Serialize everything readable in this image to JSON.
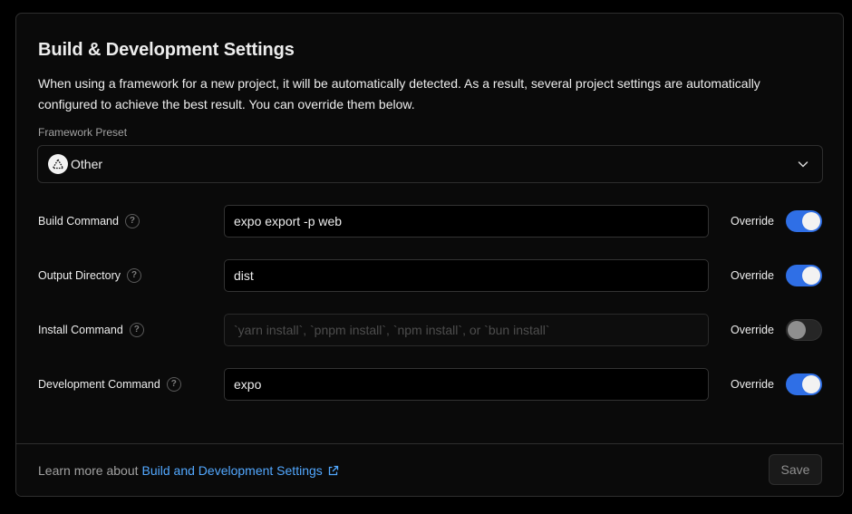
{
  "section": {
    "title": "Build & Development Settings",
    "description": "When using a framework for a new project, it will be automatically detected. As a result, several project settings are automatically configured to achieve the best result. You can override them below."
  },
  "preset": {
    "label": "Framework Preset",
    "value": "Other",
    "logo_icon": "triangle-logo-icon"
  },
  "rows": [
    {
      "label": "Build Command",
      "value": "expo export -p web",
      "placeholder": "",
      "override_label": "Override",
      "override": true
    },
    {
      "label": "Output Directory",
      "value": "dist",
      "placeholder": "",
      "override_label": "Override",
      "override": true
    },
    {
      "label": "Install Command",
      "value": "",
      "placeholder": "`yarn install`, `pnpm install`, `npm install`, or `bun install`",
      "override_label": "Override",
      "override": false
    },
    {
      "label": "Development Command",
      "value": "expo",
      "placeholder": "",
      "override_label": "Override",
      "override": true
    }
  ],
  "footer": {
    "prefix": "Learn more about",
    "link_text": "Build and Development Settings",
    "save_label": "Save"
  },
  "colors": {
    "accent": "#2f6fe6",
    "link": "#52a8ff",
    "background": "#000000",
    "card": "#0a0a0a"
  }
}
